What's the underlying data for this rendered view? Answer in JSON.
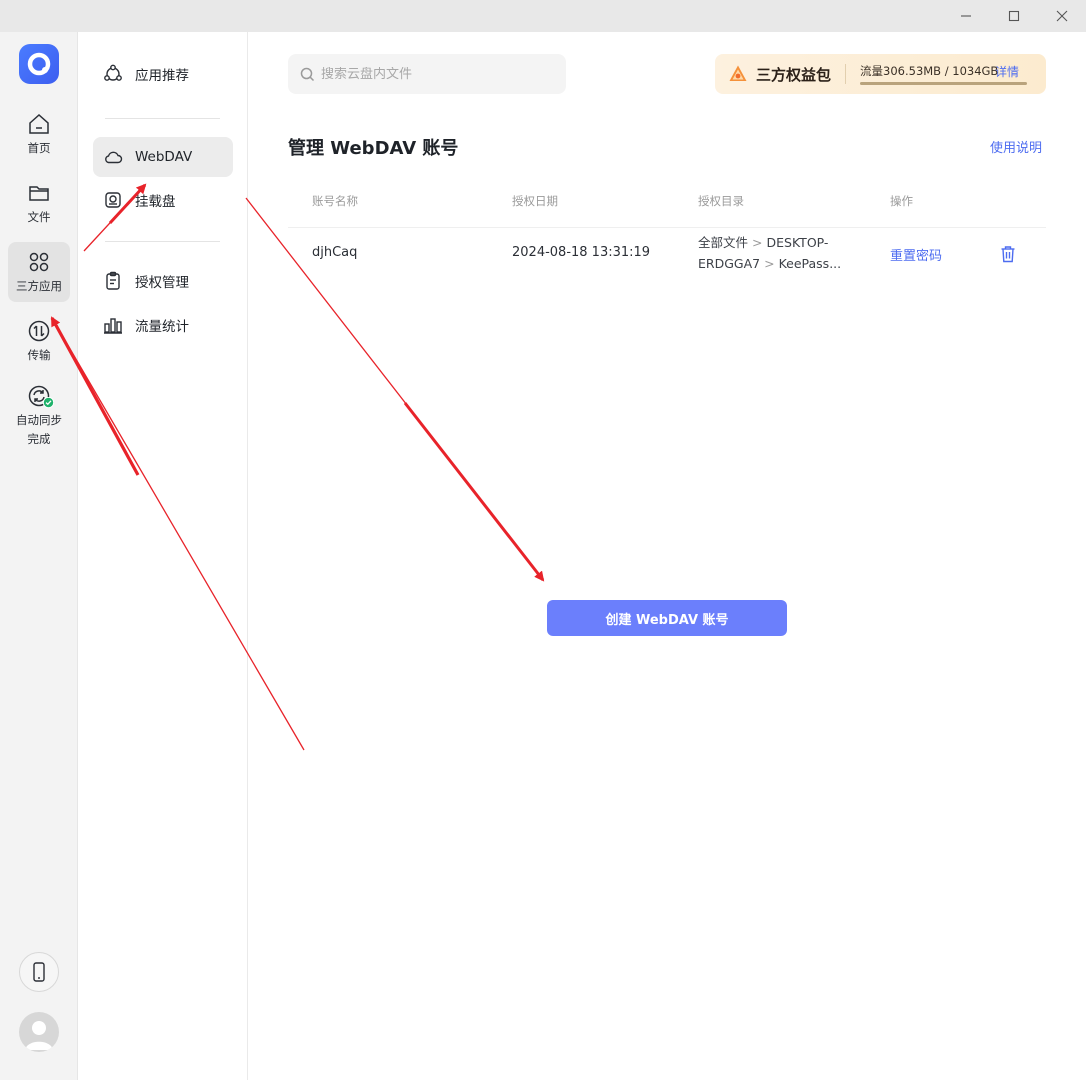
{
  "window_controls": {
    "minimize": "minimize-icon",
    "maximize": "maximize-icon",
    "close": "close-icon"
  },
  "rail": {
    "items": [
      {
        "label": "首页",
        "icon": "home-icon"
      },
      {
        "label": "文件",
        "icon": "folder-icon"
      },
      {
        "label": "三方应用",
        "icon": "apps-icon",
        "active": true
      },
      {
        "label": "传输",
        "icon": "transfer-icon"
      },
      {
        "label": "自动同步完成",
        "line1": "自动同步",
        "line2": "完成",
        "icon": "sync-complete-icon"
      }
    ],
    "bottom": [
      "phone-icon",
      "avatar"
    ]
  },
  "sidebar": {
    "items": [
      {
        "label": "应用推荐",
        "icon": "apps-recommend-icon"
      },
      {
        "label": "WebDAV",
        "icon": "cloud-icon",
        "active": true
      },
      {
        "label": "挂载盘",
        "icon": "mount-disk-icon"
      },
      {
        "label": "授权管理",
        "icon": "authorization-icon"
      },
      {
        "label": "流量统计",
        "icon": "bar-chart-icon"
      }
    ]
  },
  "search": {
    "placeholder": "搜索云盘内文件"
  },
  "promo": {
    "title": "三方权益包",
    "traffic": "流量306.53MB / 1034GB",
    "traffic_used_fraction": 0.0003,
    "detail": "详情"
  },
  "main": {
    "title": "管理 WebDAV 账号",
    "help": "使用说明",
    "table": {
      "columns": [
        "账号名称",
        "授权日期",
        "授权目录",
        "操作"
      ],
      "rows": [
        {
          "account": "djhCaq",
          "date": "2024-08-18 13:31:19",
          "dir_part1": "全部文件",
          "dir_sep": ">",
          "dir_part2": "DESKTOP-",
          "dir_part3": "ERDGGA7",
          "dir_part4": "KeePass...",
          "action": "重置密码"
        }
      ]
    },
    "create_button": "创建 WebDAV 账号"
  },
  "colors": {
    "accent": "#4d6cf0",
    "button": "#6b7ffc",
    "arrow": "#e8232a"
  }
}
